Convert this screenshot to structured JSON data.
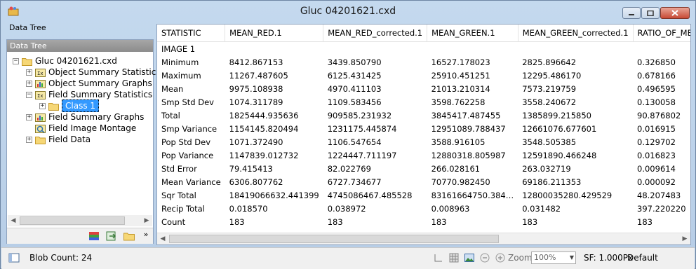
{
  "window": {
    "title": "Gluc 04201621.cxd"
  },
  "left_panel": {
    "title": "Data Tree",
    "header": "Data Tree",
    "tree": [
      {
        "label": "Gluc 04201621.cxd",
        "expander": "−",
        "icon": "folder-icon",
        "level": 0
      },
      {
        "label": "Object Summary Statistics",
        "expander": "+",
        "icon": "stats-icon",
        "level": 1
      },
      {
        "label": "Object Summary Graphs",
        "expander": "+",
        "icon": "graph-icon",
        "level": 1
      },
      {
        "label": "Field Summary Statistics",
        "expander": "−",
        "icon": "stats-icon",
        "level": 1
      },
      {
        "label": "Class 1",
        "expander": "+",
        "icon": "folder-icon",
        "level": 2,
        "selected": true
      },
      {
        "label": "Field Summary Graphs",
        "expander": "+",
        "icon": "graph-icon",
        "level": 1
      },
      {
        "label": "Field Image Montage",
        "expander": "",
        "icon": "montage-icon",
        "level": 1
      },
      {
        "label": "Field Data",
        "expander": "+",
        "icon": "folder-icon",
        "level": 1
      }
    ],
    "toolbar_icons": [
      "palette-icon",
      "export-icon",
      "open-folder-icon",
      "more-icon"
    ],
    "more_label": "»"
  },
  "table": {
    "columns": [
      "STATISTIC",
      "MEAN_RED.1",
      "MEAN_RED_corrected.1",
      "MEAN_GREEN.1",
      "MEAN_GREEN_corrected.1",
      "RATIO_OF_MEANS_R"
    ],
    "group_label": "IMAGE 1",
    "rows": [
      [
        "Minimum",
        "8412.867153",
        "3439.850790",
        "16527.178023",
        "2825.896642",
        "0.326850"
      ],
      [
        "Maximum",
        "11267.487605",
        "6125.431425",
        "25910.451251",
        "12295.486170",
        "0.678166"
      ],
      [
        "Mean",
        "9975.108938",
        "4970.411103",
        "21013.210314",
        "7573.219759",
        "0.496595"
      ],
      [
        "Smp Std Dev",
        "1074.311789",
        "1109.583456",
        "3598.762258",
        "3558.240672",
        "0.130058"
      ],
      [
        "Total",
        "1825444.935636",
        "909585.231932",
        "3845417.487455",
        "1385899.215850",
        "90.876802"
      ],
      [
        "Smp Variance",
        "1154145.820494",
        "1231175.445874",
        "12951089.788437",
        "12661076.677601",
        "0.016915"
      ],
      [
        "Pop Std Dev",
        "1071.372490",
        "1106.547654",
        "3588.916105",
        "3548.505385",
        "0.129702"
      ],
      [
        "Pop Variance",
        "1147839.012732",
        "1224447.711197",
        "12880318.805987",
        "12591890.466248",
        "0.016823"
      ],
      [
        "Std Error",
        "79.415413",
        "82.022769",
        "266.028161",
        "263.032719",
        "0.009614"
      ],
      [
        "Mean Variance",
        "6306.807762",
        "6727.734677",
        "70770.982450",
        "69186.211353",
        "0.000092"
      ],
      [
        "Sqr Total",
        "18419066632.441399",
        "4745086467.485528",
        "83161664750.384…",
        "12800035280.429529",
        "48.207483"
      ],
      [
        "Recip Total",
        "0.018570",
        "0.038972",
        "0.008963",
        "0.031482",
        "397.220220"
      ],
      [
        "Count",
        "183",
        "183",
        "183",
        "183",
        "183"
      ]
    ]
  },
  "status": {
    "blob_count": "Blob Count: 24",
    "zoom_label": "Zoom",
    "zoom_value": "100%",
    "sf": "SF: 1.000Px",
    "default": "Default"
  },
  "colors": {
    "accent": "#3399ff",
    "frame": "#b9d1ea",
    "close": "#c74a35"
  }
}
